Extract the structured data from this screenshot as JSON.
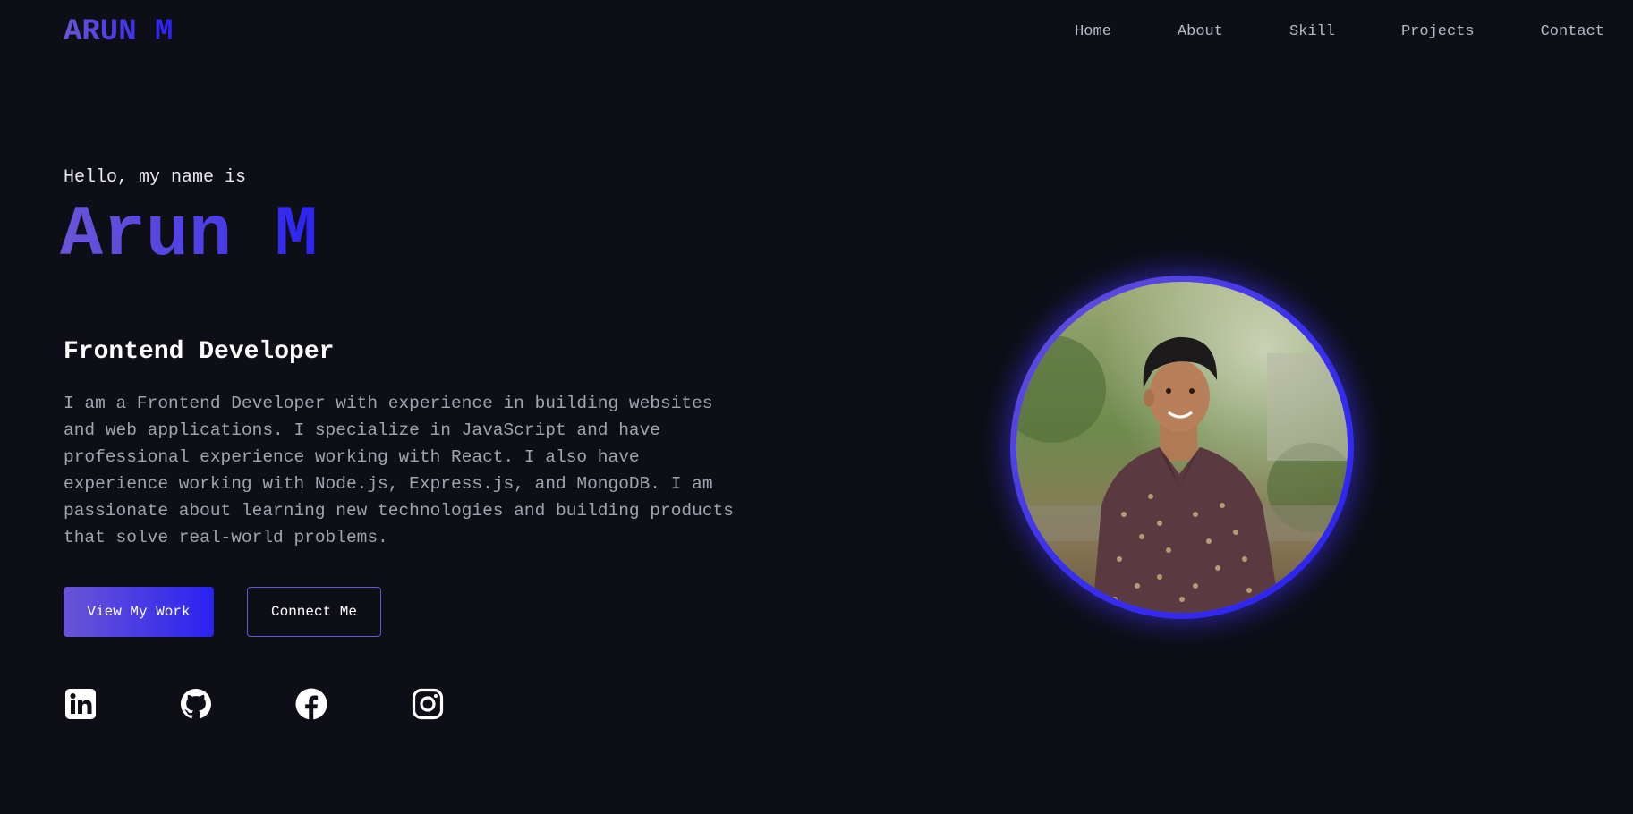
{
  "header": {
    "logo": "ARUN M",
    "nav": [
      "Home",
      "About",
      "Skill",
      "Projects",
      "Contact"
    ]
  },
  "hero": {
    "greeting": "Hello, my name is",
    "name": "Arun M",
    "role": "Frontend Developer",
    "bio": "I am a Frontend Developer with experience in building websites and web applications. I specialize in JavaScript and have professional experience working with React. I also have experience working with Node.js, Express.js, and MongoDB. I am passionate about learning new technologies and building products that solve real-world problems.",
    "primary_button": "View My Work",
    "secondary_button": "Connect Me"
  },
  "social": {
    "icons": [
      "linkedin-icon",
      "github-icon",
      "facebook-icon",
      "instagram-icon"
    ]
  },
  "colors": {
    "background": "#0e0e17",
    "accent_start": "#6a55d6",
    "accent_end": "#2a22f0",
    "text_primary": "#ffffff",
    "text_muted": "#a3a3ad"
  }
}
